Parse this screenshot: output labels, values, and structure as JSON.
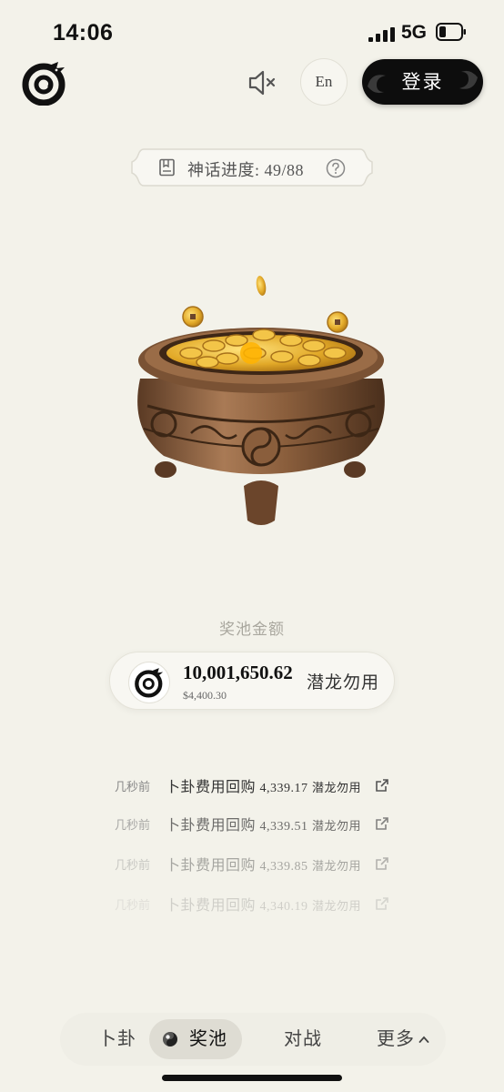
{
  "status_bar": {
    "time": "14:06",
    "network": "5G"
  },
  "header": {
    "language_label": "En",
    "login_label": "登录"
  },
  "progress": {
    "text": "神话进度: 49/88"
  },
  "prize_pool": {
    "label": "奖池金额",
    "amount": "10,001,650.62",
    "usd": "$4,400.30",
    "token": "潜龙勿用"
  },
  "feed": [
    {
      "ago": "几秒前",
      "action": "卜卦费用回购",
      "amount": "4,339.17",
      "token": "潜龙勿用",
      "opacity": 1.0
    },
    {
      "ago": "几秒前",
      "action": "卜卦费用回购",
      "amount": "4,339.51",
      "token": "潜龙勿用",
      "opacity": 0.7
    },
    {
      "ago": "几秒前",
      "action": "卜卦费用回购",
      "amount": "4,339.85",
      "token": "潜龙勿用",
      "opacity": 0.4
    },
    {
      "ago": "几秒前",
      "action": "卜卦费用回购",
      "amount": "4,340.19",
      "token": "潜龙勿用",
      "opacity": 0.18
    }
  ],
  "nav": {
    "items": [
      {
        "label": "卜卦",
        "active": false
      },
      {
        "label": "奖池",
        "active": true
      },
      {
        "label": "对战",
        "active": false
      },
      {
        "label": "更多",
        "active": false
      }
    ]
  },
  "icons": [
    "dragon-logo-icon",
    "mute-icon",
    "book-icon",
    "help-icon",
    "external-link-icon",
    "yin-yang-icon",
    "chevron-up-icon",
    "signal-icon",
    "battery-icon"
  ],
  "colors": {
    "background": "#f3f2ea",
    "login_bg": "#0d0d0d",
    "nav_bg": "#efeee6",
    "nav_active_bg": "#dedcd3"
  }
}
